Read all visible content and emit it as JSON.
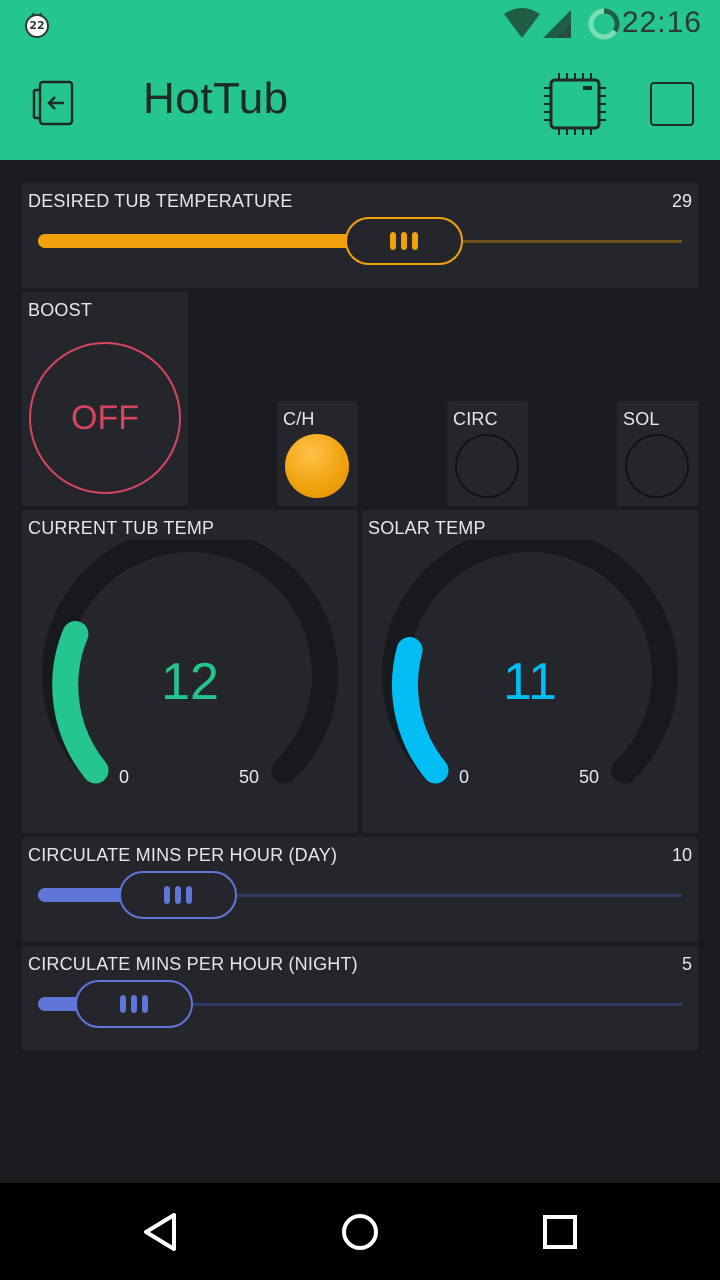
{
  "status_bar": {
    "notification_badge": "22",
    "time": "22:16"
  },
  "app_bar": {
    "title": "HotTub",
    "icons": [
      "exit-icon",
      "device-chip-icon",
      "stop-square-icon"
    ]
  },
  "widgets": {
    "desired_temp": {
      "label": "DESIRED TUB TEMPERATURE",
      "value": "29",
      "level": 0.58,
      "color": "#f0a10c"
    },
    "boost": {
      "label": "BOOST",
      "state": "OFF",
      "color": "#d8465e"
    },
    "leds": [
      {
        "label": "C/H",
        "on": true,
        "color": "#f0a10c"
      },
      {
        "label": "CIRC",
        "on": false
      },
      {
        "label": "SOL",
        "on": false
      }
    ],
    "current_temp": {
      "label": "CURRENT TUB TEMP",
      "value": "12",
      "min": "0",
      "max": "50",
      "color": "#24c68e"
    },
    "solar_temp": {
      "label": "SOLAR TEMP",
      "value": "11",
      "min": "0",
      "max": "50",
      "color": "#03bdf5"
    },
    "circ_day": {
      "label": "CIRCULATE MINS PER HOUR (DAY)",
      "value": "10",
      "level": 0.17,
      "color": "#5f75d8"
    },
    "circ_night": {
      "label": "CIRCULATE MINS PER HOUR (NIGHT)",
      "value": "5",
      "level": 0.08,
      "color": "#5f75d8"
    }
  },
  "nav": [
    "back-icon",
    "home-icon",
    "recents-icon"
  ]
}
